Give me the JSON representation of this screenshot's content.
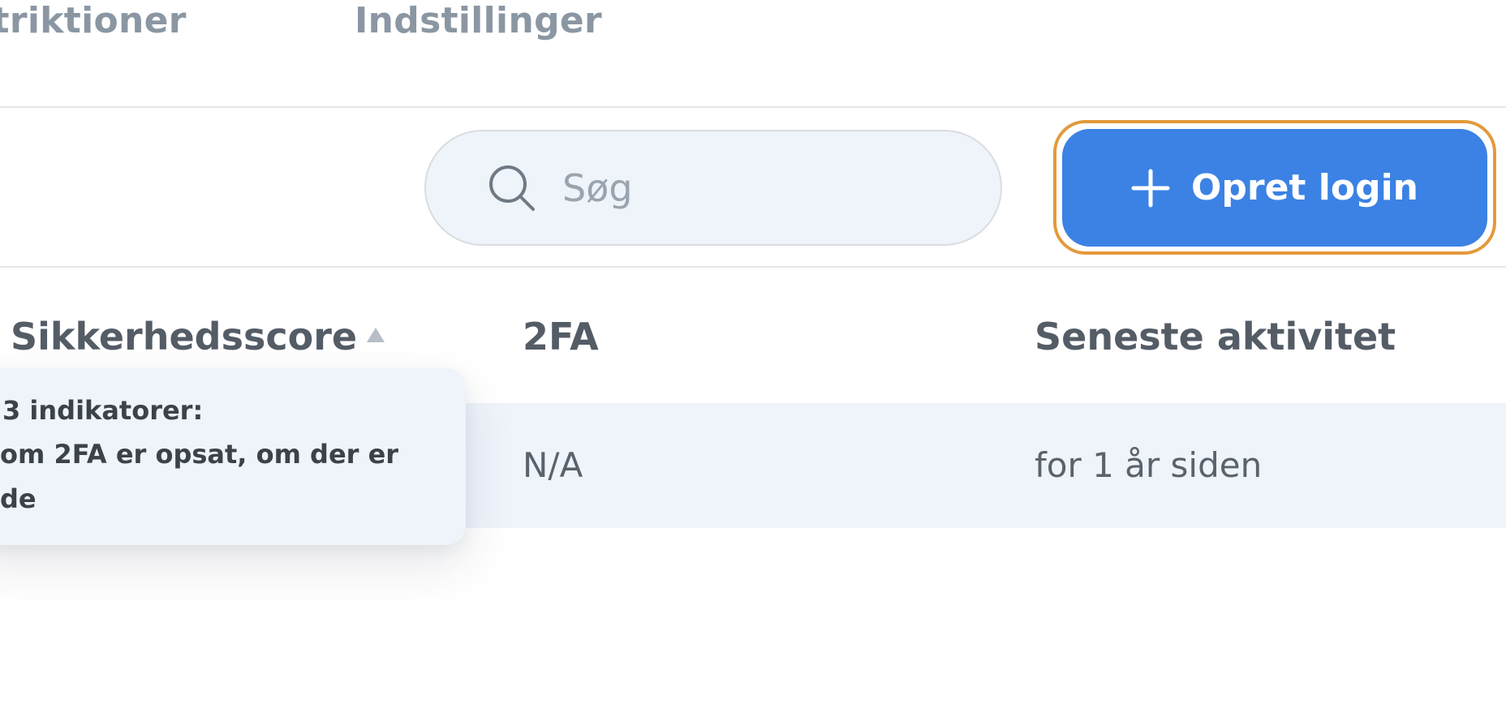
{
  "tabs": {
    "restrictions_label": "striktioner",
    "settings_label": "Indstillinger"
  },
  "toolbar": {
    "search": {
      "placeholder": "Søg",
      "value": "",
      "icon": "search-icon"
    },
    "create_button": {
      "label": "Opret login",
      "icon": "plus-icon"
    }
  },
  "table": {
    "headers": {
      "score": "Sikkerhedsscore",
      "twofa": "2FA",
      "activity": "Seneste aktivitet"
    },
    "sort": "ascending",
    "rows": [
      {
        "twofa": "N/A",
        "activity": "for 1 år siden"
      }
    ]
  },
  "tooltip": {
    "lines": [
      "3 indikatorer:",
      "om 2FA er opsat, om der er",
      "ode"
    ]
  },
  "colors": {
    "accent": "#3b82e4",
    "focus_ring": "#e39a3c",
    "row_background": "#eff3fa",
    "tab_text": "#8a97a3"
  }
}
